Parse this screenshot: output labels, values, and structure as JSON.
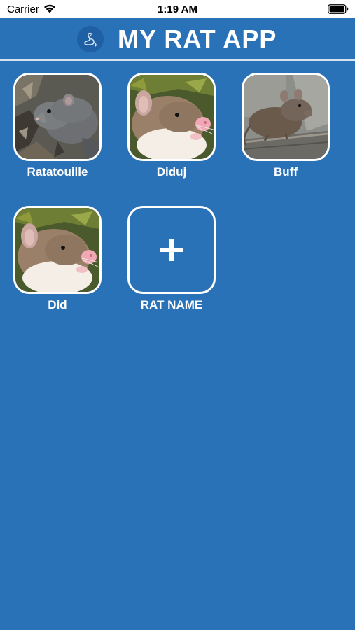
{
  "status_bar": {
    "carrier": "Carrier",
    "time": "1:19 AM"
  },
  "header": {
    "title": "MY RAT APP",
    "logo_icon": "rat-logo-icon"
  },
  "rats": [
    {
      "name": "Ratatouille",
      "photo": "grey rat in leaves"
    },
    {
      "name": "Diduj",
      "photo": "white-bellied rat with pink nose"
    },
    {
      "name": "Buff",
      "photo": "brown rat on wood"
    },
    {
      "name": "Did",
      "photo": "white-bellied rat with pink nose"
    }
  ],
  "add_tile": {
    "label": "RAT NAME",
    "icon": "plus-icon"
  },
  "colors": {
    "background": "#2a72b8",
    "status_bar": "#ffffff",
    "text": "#ffffff"
  }
}
